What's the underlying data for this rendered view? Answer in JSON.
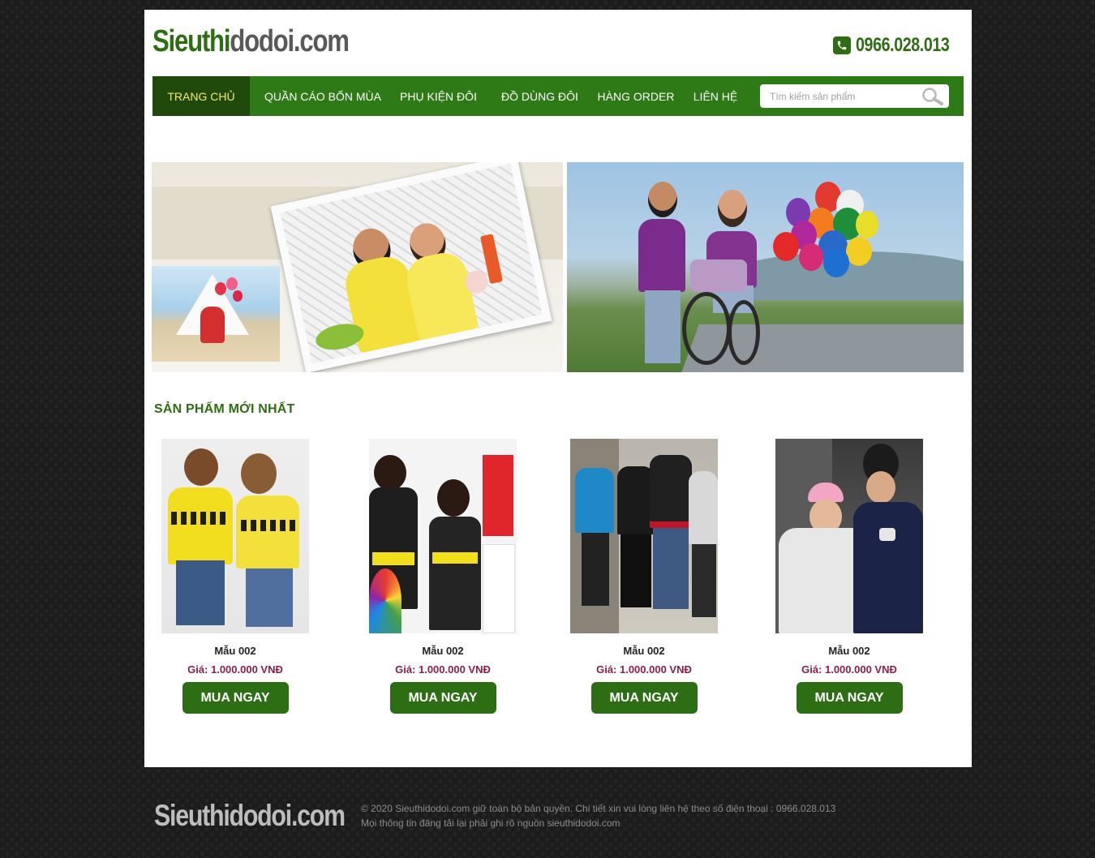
{
  "header": {
    "logo_part1": "Sieuthi",
    "logo_part2": "dodoi.com",
    "phone": "0966.028.013"
  },
  "nav": {
    "items": [
      {
        "label": "TRANG CHỦ",
        "active": true
      },
      {
        "label": "QUẦN CÁO BỐN MÙA",
        "active": false
      },
      {
        "label": "PHỤ KIỆN ĐÔI",
        "active": false
      },
      {
        "label": "ĐỒ DÙNG ĐÔI",
        "active": false
      },
      {
        "label": "HÀNG ORDER",
        "active": false
      },
      {
        "label": "LIÊN HỆ",
        "active": false
      }
    ],
    "search_placeholder": "Tìm kiếm sản phẩm"
  },
  "section": {
    "title": "SẢN PHẨM MỚI NHẤT"
  },
  "products": [
    {
      "name": "Mẫu 002",
      "price": "Giá: 1.000.000 VNĐ",
      "button": "MUA NGAY"
    },
    {
      "name": "Mẫu 002",
      "price": "Giá: 1.000.000 VNĐ",
      "button": "MUA NGAY"
    },
    {
      "name": "Mẫu 002",
      "price": "Giá: 1.000.000 VNĐ",
      "button": "MUA NGAY"
    },
    {
      "name": "Mẫu 002",
      "price": "Giá: 1.000.000 VNĐ",
      "button": "MUA NGAY"
    }
  ],
  "footer": {
    "logo": "Sieuthidodoi.com",
    "line1": "© 2020 Sieuthidodoi.com giữ toàn bộ bản quyền. Chi tiết xin vui lòng liên hệ theo số điện thoại : 0966.028.013",
    "line2": "Mọi thông tin đăng tải lại phải ghi rõ nguồn sieuthidodoi.com"
  },
  "colors": {
    "brand_green": "#2e6e12",
    "nav_green": "#2e7a16",
    "nav_active": "#1f4a0b",
    "active_text": "#f6e96b",
    "price": "#8b1f49"
  }
}
